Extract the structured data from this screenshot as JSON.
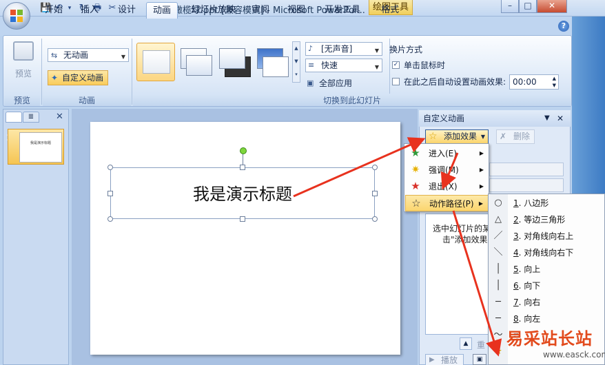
{
  "window": {
    "title": "橄榄球.ppt [兼容模式] - Microsoft PowerPoi...",
    "tools_tab": "绘图工具",
    "buttons": {
      "minimize": "–",
      "maximize": "□",
      "close": "✕"
    }
  },
  "quick_access": {
    "save": "💾",
    "undo": "↶",
    "undo_dd": "▾",
    "redo": "↻",
    "print": "🖶",
    "cut": "✂",
    "more": "▾"
  },
  "tabs": [
    "开始",
    "插入",
    "设计",
    "动画",
    "幻灯片放映",
    "审阅",
    "视图",
    "开发工具",
    "格式"
  ],
  "active_tab": "动画",
  "ribbon": {
    "preview": {
      "label": "预览",
      "group": "预览"
    },
    "animation": {
      "select_value": "无动画",
      "custom_button": "自定义动画",
      "group": "动画"
    },
    "transition": {
      "sound_value": "[无声音]",
      "speed_value": "快速",
      "apply_all": "全部应用",
      "switch_label": "换片方式",
      "on_click": "单击鼠标时",
      "auto_after": "在此之后自动设置动画效果:",
      "time_value": "00:00",
      "group": "切换到此幻灯片"
    }
  },
  "slide_panel": {
    "slide_number": "1",
    "thumb_text": "我是演示标题"
  },
  "slide": {
    "title": "我是演示标题"
  },
  "custom_animation_pane": {
    "title": "自定义动画",
    "add_effect": "添加效果",
    "delete": "删除",
    "hint_line1": "选中幻灯片的某",
    "hint_line2": "击\"添加效果",
    "reorder": "重",
    "play": "播放"
  },
  "add_effect_menu": [
    {
      "label": "进入(E)",
      "icon": "enter-star"
    },
    {
      "label": "强调(M)",
      "icon": "emphasis-star"
    },
    {
      "label": "退出(X)",
      "icon": "exit-star"
    },
    {
      "label": "动作路径(P)",
      "icon": "path-star",
      "highlighted": true
    }
  ],
  "motion_path_menu": [
    {
      "num": "1",
      "label": ". 八边形",
      "icon": "○"
    },
    {
      "num": "2",
      "label": ". 等边三角形",
      "icon": "△"
    },
    {
      "num": "3",
      "label": ". 对角线向右上",
      "icon": "／"
    },
    {
      "num": "4",
      "label": ". 对角线向右下",
      "icon": "＼"
    },
    {
      "num": "5",
      "label": ". 向上",
      "icon": "│"
    },
    {
      "num": "6",
      "label": ". 向下",
      "icon": "│"
    },
    {
      "num": "7",
      "label": ". 向右",
      "icon": "─"
    },
    {
      "num": "8",
      "label": ". 向左",
      "icon": "─"
    },
    {
      "num": "",
      "label": "绘",
      "icon": "〜"
    },
    {
      "num": "",
      "label": "",
      "icon": "★"
    }
  ],
  "watermark": {
    "text": "易采站长站",
    "url": "www.easck.com"
  },
  "colors": {
    "accent": "#f9cc5b",
    "arrow": "#e8321e"
  }
}
